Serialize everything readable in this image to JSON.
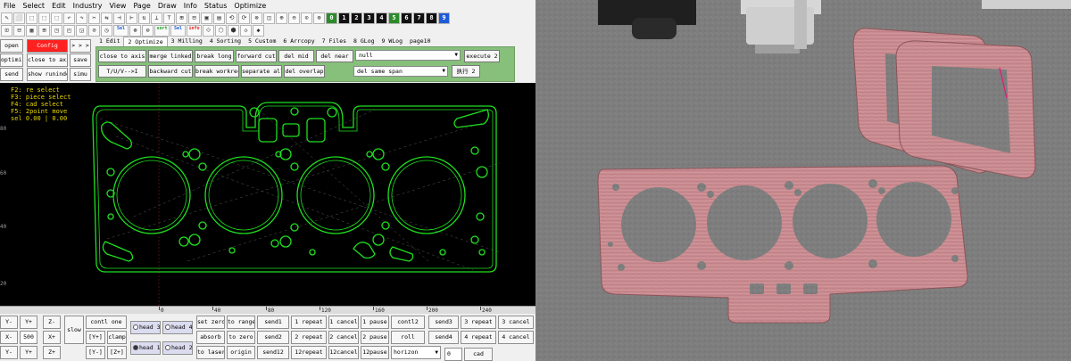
{
  "menu": [
    "File",
    "Select",
    "Edit",
    "Industry",
    "View",
    "Page",
    "Draw",
    "Info",
    "Status",
    "Optimize"
  ],
  "toolbar1": [
    "✎",
    "⬜",
    "⬚",
    "⬚",
    "⬚",
    "↶",
    "↷",
    "✂",
    "⇆",
    "⊣",
    "⊢",
    "⇅",
    "⊥",
    "⊤",
    "⊞",
    "⊟",
    "▣",
    "▤",
    "⟲",
    "⟳",
    "⊗",
    "◫",
    "⊕",
    "⊖",
    "⊙",
    "⊚"
  ],
  "toolbar1_nums": [
    "0",
    "1",
    "2",
    "3",
    "4",
    "5",
    "6",
    "7",
    "8",
    "9"
  ],
  "toolbar2": [
    "⊡",
    "⊟",
    "▦",
    "⊞",
    "◳",
    "◰",
    "◲",
    "⊘",
    "◷",
    "⊛",
    "⊜",
    "⟐",
    "⬡",
    "⬢",
    "◇",
    "◆"
  ],
  "toolbar2_text": {
    "sel_label": "Sel",
    "sort_label": "sort",
    "sel2_label": "Sel",
    "info_label": "info"
  },
  "left_buttons": {
    "open": "open",
    "config": "Config",
    "arrows": "> > >",
    "optimize": "optimize",
    "close_to_axis": "close to axis",
    "save": "save",
    "send": "send",
    "show_runindex": "show runindex",
    "simu": "simu"
  },
  "tabs": [
    "1 Edit",
    "2 Optimize",
    "3 Milling",
    "4 Sorting",
    "5 Custom",
    "6 Arrcopy",
    "7 Files",
    "8 GLog",
    "9 WLog",
    "page10"
  ],
  "active_tab": 1,
  "optimize": {
    "close_to_axis": "close to axis",
    "merge_linked": "merge linked",
    "break_long": "break long",
    "forward_cut": "forward cut",
    "del_mid": "del mid",
    "del_near": "del near",
    "null_select": "null",
    "execute2": "execute 2",
    "tuv": "T/U/V-->I",
    "backward_cut": "backward cut",
    "break_workrect": "break workrect",
    "separate_all": "separate all",
    "del_overlap": "del overlap",
    "del_same_span": "del same span",
    "exec2_cn": "执行 2"
  },
  "help_lines": [
    "F2: re select",
    "F3: piece select",
    "F4: cad select",
    "F5: 2point move",
    "sel 0.00 | 0.00"
  ],
  "x_ruler": [
    "0",
    "40",
    "80",
    "120",
    "160",
    "200",
    "240"
  ],
  "y_ruler": [
    "80",
    "60",
    "40",
    "20"
  ],
  "bottom": {
    "ym": "Y-",
    "yp": "Y+",
    "zm": "Z-",
    "xm": "X-",
    "step": "500",
    "xp": "X+",
    "ym2": "Y-",
    "yp2": "Y+",
    "zp": "Z+",
    "slow": "slow",
    "contl_one": "contl one",
    "y_bracket": "[Y+]",
    "clamp": "clamp",
    "y_bracket2": "[Y-]",
    "z_bracket": "[Z+]",
    "head3": "head 3",
    "head4": "head 4",
    "head1": "head 1",
    "head2": "head 2",
    "set_zero": "set zero",
    "absorb": "absorb",
    "to_laser": "to laser",
    "to_range": "to range",
    "to_zero": "to zero",
    "origin": "origin",
    "send1": "send1",
    "send2": "send2",
    "send12": "send12",
    "repeat1": "1 repeat",
    "repeat2": "2 repeat",
    "repeat12": "12repeat",
    "cancel1": "1 cancel",
    "cancel2": "2 cancel",
    "cancel12": "12cancel",
    "pause1": "1 pause",
    "pause2": "2 pause",
    "pause12": "12pause",
    "contl2": "contl2",
    "roll": "roll",
    "horizon": "horizon",
    "send3": "send3",
    "send4": "send4",
    "zero_val": "0",
    "repeat3": "3 repeat",
    "repeat4": "4 repeat",
    "cad": "cad",
    "cancel3": "3 cancel",
    "cancel4": "4 cancel"
  },
  "colors": {
    "contour": "#1fe01f",
    "canvas": "#000000",
    "panel": "#86c07b",
    "gasket": "#c98a8e",
    "floor": "#7b7b7b"
  }
}
